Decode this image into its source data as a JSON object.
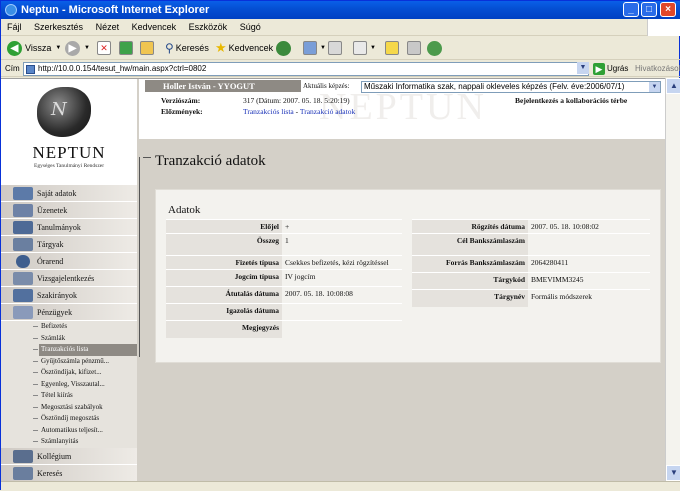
{
  "window": {
    "title": "Neptun - Microsoft Internet Explorer"
  },
  "menu": [
    "Fájl",
    "Szerkesztés",
    "Nézet",
    "Kedvencek",
    "Eszközök",
    "Súgó"
  ],
  "toolbar": {
    "back": "Vissza",
    "search": "Keresés",
    "favorites": "Kedvencek"
  },
  "address": {
    "label": "Cím",
    "url": "http://10.0.0.154/tesut_hw/main.aspx?ctrl=0802",
    "go": "Ugrás",
    "links": "Hivatkozások"
  },
  "logo": {
    "title": "NEPTUN",
    "subtitle": "Egységes Tanulmányi Rendszer",
    "watermark": "NEPTUN"
  },
  "nav": [
    {
      "label": "Saját adatok",
      "icon": "personal-data-icon"
    },
    {
      "label": "Üzenetek",
      "icon": "messages-icon"
    },
    {
      "label": "Tanulmányok",
      "icon": "studies-icon"
    },
    {
      "label": "Tárgyak",
      "icon": "subjects-icon"
    },
    {
      "label": "Órarend",
      "icon": "timetable-icon"
    },
    {
      "label": "Vizsgajelentkezés",
      "icon": "exam-registration-icon"
    },
    {
      "label": "Szakirányok",
      "icon": "specializations-icon"
    },
    {
      "label": "Pénzügyek",
      "icon": "finances-icon"
    }
  ],
  "subnav": [
    "Befizetés",
    "Számlák",
    "Tranzakciós lista",
    "Gyűjtőszámla pénzmű...",
    "Ösztöndíjak, kifizet...",
    "Egyenleg, Visszautal...",
    "Tétel kiírás",
    "Megosztási szabályok",
    "Ösztöndíj megosztás",
    "Automatikus teljesít...",
    "Számlanyitás"
  ],
  "nav_bottom": [
    {
      "label": "Kollégium",
      "icon": "dormitory-icon"
    },
    {
      "label": "Keresés",
      "icon": "search-icon"
    }
  ],
  "header": {
    "user": "Holler István - YYOGUT",
    "training_label": "Aktuális képzés:",
    "training_value": "Műszaki Informatika szak, nappali okleveles képzés (Felv. éve:2006/07/1)",
    "version_label": "Verziószám:",
    "version_value": "317 (Dátum: 2007. 05. 18. 5:20:19)",
    "news": "Bejelentkezés a kollaborációs térbe",
    "prev_label": "Előzmények:",
    "prev_link1": "Tranzakciós lista",
    "prev_sep": " - ",
    "prev_link2": "Tranzakció adatok"
  },
  "page": {
    "title": "Tranzakció adatok",
    "panel_title": "Adatok"
  },
  "left_fields": [
    {
      "label": "Előjel",
      "value": "+"
    },
    {
      "label": "Összeg",
      "value": "1"
    },
    {
      "label": "Fizetés típusa",
      "value": "Csekkes befizetés, kézi rögzítéssel"
    },
    {
      "label": "Jogcím típusa",
      "value": "IV jogcím"
    },
    {
      "label": "Átutalás dátuma",
      "value": "2007. 05. 18. 10:08:08"
    },
    {
      "label": "Igazolás dátuma",
      "value": ""
    },
    {
      "label": "Megjegyzés",
      "value": ""
    }
  ],
  "right_fields": [
    {
      "label": "Rögzítés dátuma",
      "value": "2007. 05. 18. 10:08:02"
    },
    {
      "label": "Cél Bankszámlaszám",
      "value": ""
    },
    {
      "label": "Forrás Bankszámlaszám",
      "value": "2064280411"
    },
    {
      "label": "Tárgykód",
      "value": "BMEVIMM3245"
    },
    {
      "label": "Tárgynév",
      "value": "Formális módszerek"
    }
  ]
}
